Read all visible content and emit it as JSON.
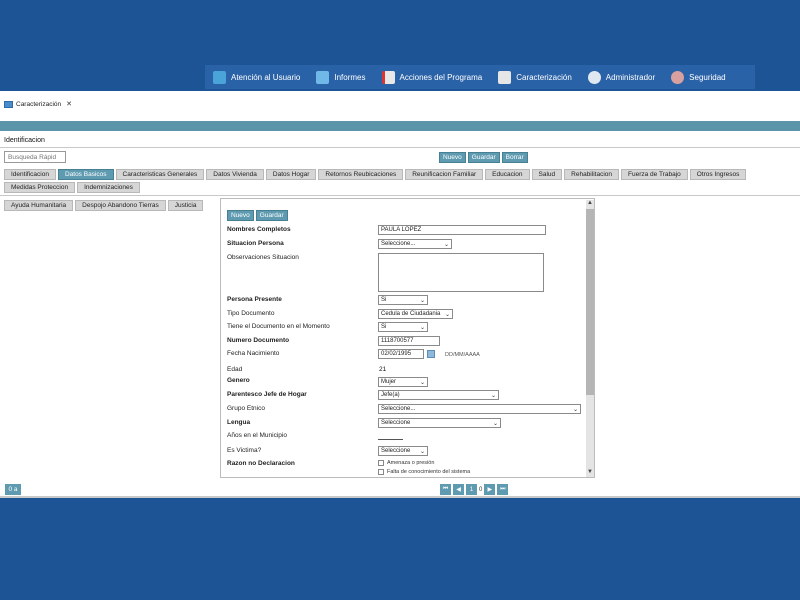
{
  "nav": {
    "items": [
      {
        "label": "Atención al Usuario",
        "icon": "users-hand-icon",
        "color": "#4aa3d9"
      },
      {
        "label": "Informes",
        "icon": "report-icon",
        "color": "#6fb8e8"
      },
      {
        "label": "Acciones del Programa",
        "icon": "document-icon",
        "color": "#e8e8e8"
      },
      {
        "label": "Caracterización",
        "icon": "clipboard-icon",
        "color": "#e6e6e6"
      },
      {
        "label": "Administrador",
        "icon": "gear-icon",
        "color": "#dfe7f0"
      },
      {
        "label": "Seguridad",
        "icon": "people-icon",
        "color": "#d9a0a0"
      }
    ]
  },
  "window_tab": {
    "label": "Caracterización",
    "close": "✕"
  },
  "section_title": "Identificacion",
  "search": {
    "placeholder": "Busqueda Rápid"
  },
  "toolbar": {
    "nuevo": "Nuevo",
    "guardar": "Guardar",
    "borrar": "Borrar"
  },
  "tabs_row1": [
    "Identificacion",
    "Datos Basicos",
    "Caracteristicas Generales",
    "Datos Vivienda",
    "Datos Hogar",
    "Retornos Reubicaciones",
    "Reunificacion Familiar",
    "Educacion",
    "Salud",
    "Rehabilitacion",
    "Fuerza de Trabajo",
    "Otros Ingresos",
    "Medidas Proteccion",
    "Indemnizaciones"
  ],
  "tabs_row3": [
    "Ayuda Humanitaria",
    "Despojo Abandono Tierras",
    "Justicia"
  ],
  "panel": {
    "nuevo": "Nuevo",
    "guardar": "Guardar",
    "fields": {
      "nombres": {
        "label": "Nombres Completos",
        "value": "PAULA LOPEZ"
      },
      "situacion": {
        "label": "Situacion Persona",
        "value": "Seleccione..."
      },
      "observaciones": {
        "label": "Observaciones Situacion"
      },
      "presente": {
        "label": "Persona Presente",
        "value": "Si"
      },
      "tipo_doc": {
        "label": "Tipo Documento",
        "value": "Cedula de Ciudadania"
      },
      "tiene_doc": {
        "label": "Tiene el Documento en el Momento",
        "value": "Si"
      },
      "numero_doc": {
        "label": "Numero Documento",
        "value": "1118700577"
      },
      "fecha_nac": {
        "label": "Fecha Nacimiento",
        "value": "02/02/1995",
        "format": "DD/MM/AAAA"
      },
      "edad": {
        "label": "Edad",
        "value": "21"
      },
      "genero": {
        "label": "Genero",
        "value": "Mujer"
      },
      "parentesco": {
        "label": "Parentesco Jefe de Hogar",
        "value": "Jefe(a)"
      },
      "grupo_etnico": {
        "label": "Grupo Etnico",
        "value": "Seleccione..."
      },
      "lengua": {
        "label": "Lengua",
        "value": "Seleccione"
      },
      "anos_municipio": {
        "label": "Años en el Municipio",
        "value": ""
      },
      "es_victima": {
        "label": "Es Victima?",
        "value": "Seleccione"
      },
      "razon": {
        "label": "Razon no Declaracion",
        "opt1": "Amenaza o presión",
        "opt2": "Falta de conocimiento del sistema"
      }
    }
  },
  "pager": {
    "info": "0 a",
    "page": "1",
    "of": "0"
  }
}
